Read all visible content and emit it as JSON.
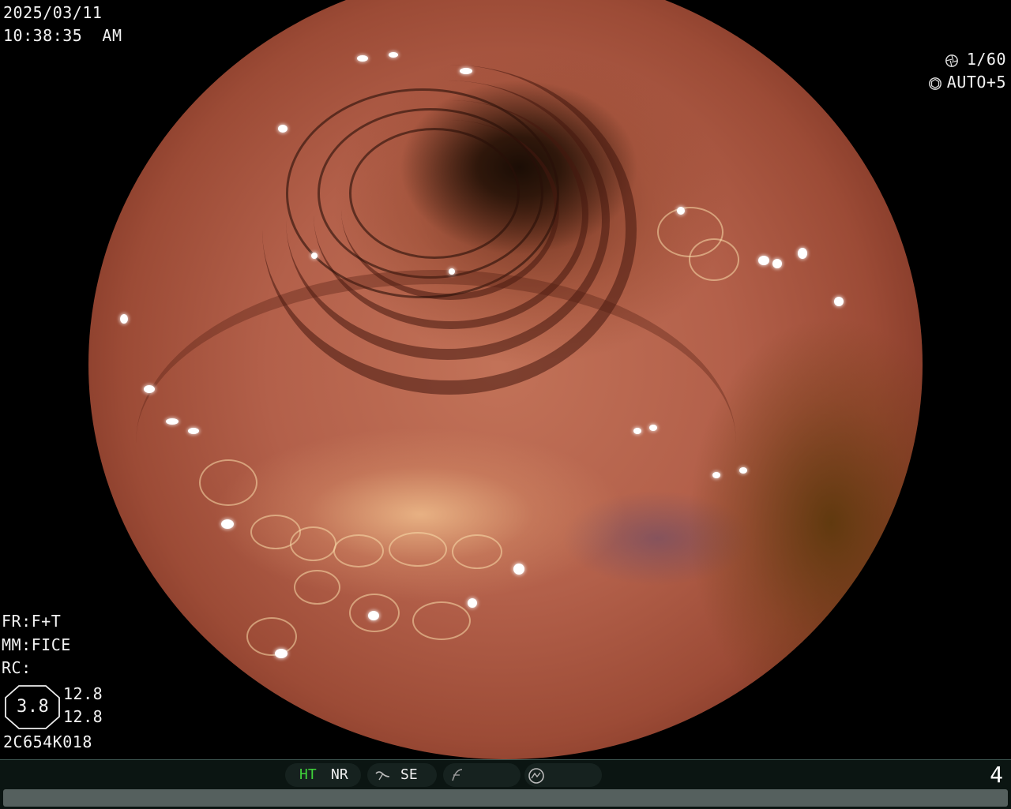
{
  "header": {
    "date": "2025/03/11",
    "time": "10:38:35  AM"
  },
  "camera": {
    "shutter": "1/60",
    "exposure": "AUTO+5",
    "shutter_icon": "shutter-icon",
    "iris_icon": "iris-icon"
  },
  "info": {
    "fr": "FR:F+T",
    "mm": "MM:FICE",
    "rc": "RC:",
    "circle_value": "3.8",
    "value_top": "12.8",
    "value_bottom": "12.8",
    "code": "2C654K018"
  },
  "statusbar": {
    "ht": "HT",
    "nr": "NR",
    "se": "SE",
    "ht_color": "#3fd23a",
    "page": "4",
    "icons": [
      "curve-icon",
      "function-icon",
      "gauge-icon"
    ]
  }
}
